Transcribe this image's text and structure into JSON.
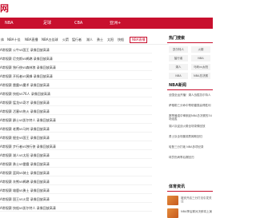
{
  "header": {
    "logo": "网"
  },
  "nav": {
    "items": [
      "NBA",
      "足球",
      "CBA",
      "亚洲+"
    ]
  },
  "subnav": {
    "items": [
      "体",
      "NBA十佳",
      "NBA直播",
      "NBA五佳球",
      "火箭",
      "猛行者",
      "湖人",
      "勇士",
      "太阳",
      "快船"
    ],
    "tag": "NBA直播"
  },
  "list": {
    "rows": [
      "A常规赛 公牛vs国王 录像回放高清",
      "A常规赛 尼克斯vs鹈鹕 录像回放高清",
      "A常规赛 独行侠vs森林狼 录像回放高清",
      "A常规赛 开拓者vs黄蜂 录像回放高清",
      "A常规赛 雷霆vs魔术 录像回放高清",
      "A常规赛 快船vs76人 录像回放高清",
      "A常规赛 猛龙vs奇才 录像回放高清",
      "A常规赛 活塞vs热火 录像回放高清",
      "A常规赛 爵士vs凯尔特人 录像回放高清",
      "A常规赛 老鹰vs马刺 录像回放高清",
      "A常规赛 掘金vs国王 录像回放高清",
      "A常规赛 步行者vs独行侠 录像回放高清",
      "A常规赛 湖人vs太阳 录像回放高清",
      "A常规赛 勇士vs雷霆 录像回放高清",
      "A常规赛 篮网vs骑士 录像回放高清",
      "A常规赛 灰熊vs鹈鹕 录像回放高清",
      "A常规赛 雄鹿vs勇士 录像回放高清",
      "A常规赛 国王vs火箭 录像回放高清",
      "A常规赛 快船vs凯尔特人 录像回放高清"
    ]
  },
  "sidebar": {
    "hot_title": "热门搜索",
    "hot_tags": [
      "凯尔特人",
      "火箭",
      "猛行者",
      "NBA",
      "湖人",
      "马刺vs太阳",
      "NBA",
      "NBA总决赛"
    ],
    "news_title": "NBA新闻",
    "news": [
      "全国全运开播！湖人战胜凯尔特人",
      "萨格勒三分命中帮助雷霆赢得胜利",
      "赛季最强中锋掀起NBA总决赛的34场连胜",
      "湖人队迎战火箭全场录像回放",
      "勇士队全场集锦詹姆斯回归",
      "哈登三分打破 NBA多项纪录",
      "球员伤病季后赛回归"
    ],
    "sports_title": "体育资讯",
    "sports": [
      "雄安开启三分打法引发关注",
      "NBA季后赛对决即将上演"
    ]
  },
  "colors": {
    "brand": "#c8102e"
  }
}
